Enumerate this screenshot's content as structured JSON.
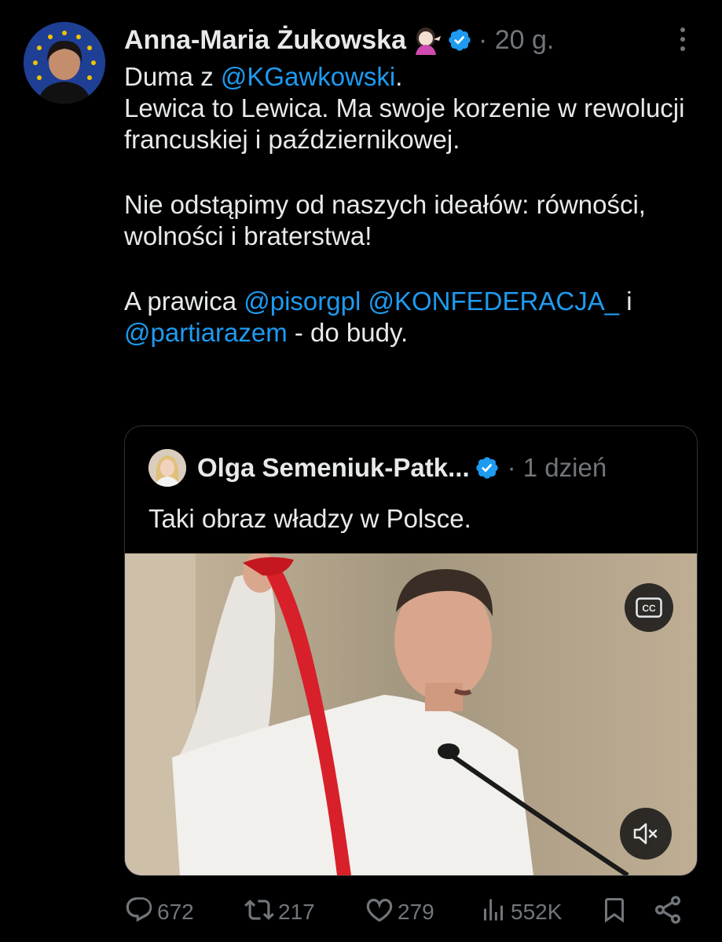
{
  "tweet": {
    "author_name": "Anna-Maria Żukowska",
    "time": "· 20 g.",
    "paragraphs": [
      [
        {
          "text": "Duma z ",
          "type": "text"
        },
        {
          "text": "@KGawkowski",
          "type": "mention"
        },
        {
          "text": ".",
          "type": "text"
        }
      ],
      [
        {
          "text": "Lewica to Lewica. Ma swoje korzenie w rewolucji francuskiej i październikowej.",
          "type": "text"
        }
      ],
      [],
      [
        {
          "text": "Nie odstąpimy od naszych ideałów: równości, wolności i braterstwa!",
          "type": "text"
        }
      ],
      [],
      [
        {
          "text": "A prawica ",
          "type": "text"
        },
        {
          "text": "@pisorgpl",
          "type": "mention"
        },
        {
          "text": " ",
          "type": "text"
        },
        {
          "text": "@KONFEDERACJA_",
          "type": "mention"
        },
        {
          "text": " i ",
          "type": "text"
        },
        {
          "text": "@partiarazem",
          "type": "mention"
        },
        {
          "text": " - do budy.",
          "type": "text"
        }
      ]
    ]
  },
  "quote": {
    "author_name": "Olga Semeniuk-Patk...",
    "time": "· 1 dzień",
    "text": "Taki obraz władzy w Polsce."
  },
  "actions": {
    "replies": "672",
    "retweets": "217",
    "likes": "279",
    "views": "552K"
  },
  "icons": {
    "verified": "verified-badge-icon",
    "emoji": "woman-tipping-hand-emoji",
    "cc": "closed-captions-icon",
    "mute": "muted-speaker-icon"
  },
  "colors": {
    "background": "#000000",
    "text": "#e7e9ea",
    "muted": "#71767b",
    "accent": "#1d9bf0"
  }
}
